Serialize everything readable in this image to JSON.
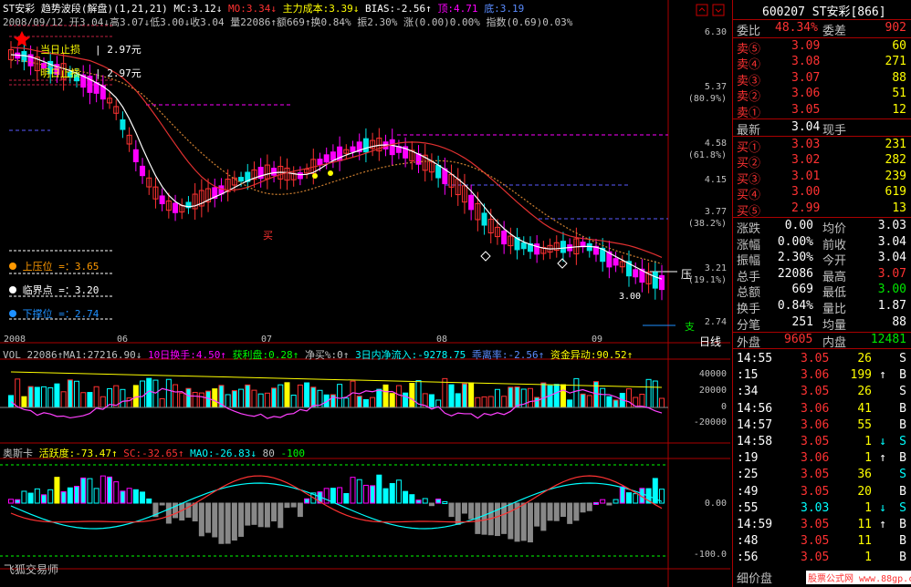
{
  "header": {
    "stock": "ST安彩",
    "indicator": "趋势波段(解盘)(1,21,21)",
    "mc": "MC:3.12↓",
    "mo": "MO:3.34↓",
    "zlcb": "主力成本:3.39↓",
    "bias": "BIAS:-2.56↑",
    "top": "顶:4.71",
    "bottom": "底:3.19",
    "ohlc_line": "2008/09/12 开3.04↓高3.07↓低3.00↓收3.04 量22086↑额669↑换0.84% 振2.30% 涨(0.00)0.00% 指数(0.69)0.03%"
  },
  "main_chart": {
    "today_stop": "当日止损",
    "today_stop_val": "| 2.97元",
    "tomorrow_stop": "明日止损",
    "tomorrow_stop_val": "| 2.97元",
    "buy_label": "买",
    "pressure_label": "压",
    "support_label": "支",
    "low_mark": "3.00",
    "legend": [
      {
        "label": "上压位",
        "value": "=：3.65",
        "color": "#ff9900"
      },
      {
        "label": "临界点",
        "value": "=：3.20",
        "color": "#ffffff"
      },
      {
        "label": "下撑位",
        "value": "=：2.74",
        "color": "#1e90ff"
      }
    ],
    "price_ticks": [
      "6.30",
      "5.37",
      "(80.9%)",
      "4.58",
      "(61.8%)",
      "4.15",
      "3.77",
      "(38.2%)",
      "3.21",
      "(19.1%)",
      "2.74"
    ],
    "months": [
      "2008",
      "06",
      "07",
      "08",
      "09"
    ],
    "y_axis_label": "日线"
  },
  "volume_panel": {
    "header_parts": [
      {
        "t": "VOL 22086↑MA1:27216.90↓",
        "c": "#c0c0c0"
      },
      {
        "t": "10日换手:4.50↑",
        "c": "#ff00ff"
      },
      {
        "t": "获利盘:0.28↑",
        "c": "#00ff00"
      },
      {
        "t": "净买%:0↑",
        "c": "#c0c0c0"
      },
      {
        "t": "3日内净流入:-9278.75",
        "c": "#00ffff"
      },
      {
        "t": "乖离率:-2.56↑",
        "c": "#5a8cff"
      },
      {
        "t": "资金异动:90.52↑",
        "c": "#ffff00"
      }
    ],
    "ticks": [
      "40000",
      "20000",
      "0",
      "-20000"
    ]
  },
  "osc_panel": {
    "header_parts": [
      {
        "t": "奥斯卡",
        "c": "#c0c0c0"
      },
      {
        "t": "活跃度:-73.47↑",
        "c": "#ffff00"
      },
      {
        "t": "SC:-32.65↑",
        "c": "#ff3232"
      },
      {
        "t": "MAO:-26.83↓",
        "c": "#00ffff"
      },
      {
        "t": "80",
        "c": "#c0c0c0"
      },
      {
        "t": "-100",
        "c": "#00ff00"
      }
    ],
    "ticks": [
      "0.00",
      "-100.0"
    ],
    "footer": "飞狐交易师"
  },
  "quote": {
    "code_title": "600207 ST安彩[866]",
    "weibi_label": "委比",
    "weibi_value": "48.34%",
    "weicha_label": "委差",
    "weicha_value": "902",
    "sells": [
      {
        "label": "卖⑤",
        "price": "3.09",
        "vol": "60"
      },
      {
        "label": "卖④",
        "price": "3.08",
        "vol": "271"
      },
      {
        "label": "卖③",
        "price": "3.07",
        "vol": "88"
      },
      {
        "label": "卖②",
        "price": "3.06",
        "vol": "51"
      },
      {
        "label": "卖①",
        "price": "3.05",
        "vol": "12"
      }
    ],
    "latest_label": "最新",
    "latest_value": "3.04",
    "current_hand_label": "现手",
    "current_hand_value": "",
    "buys": [
      {
        "label": "买①",
        "price": "3.03",
        "vol": "231"
      },
      {
        "label": "买②",
        "price": "3.02",
        "vol": "282"
      },
      {
        "label": "买③",
        "price": "3.01",
        "vol": "239"
      },
      {
        "label": "买④",
        "price": "3.00",
        "vol": "619"
      },
      {
        "label": "买⑤",
        "price": "2.99",
        "vol": "13"
      }
    ],
    "stats": [
      {
        "l1": "涨跌",
        "v1": "0.00",
        "l2": "均价",
        "v2": "3.03",
        "c1": "#fff",
        "c2": "#fff"
      },
      {
        "l1": "涨幅",
        "v1": "0.00%",
        "l2": "前收",
        "v2": "3.04",
        "c1": "#fff",
        "c2": "#fff"
      },
      {
        "l1": "振幅",
        "v1": "2.30%",
        "l2": "今开",
        "v2": "3.04",
        "c1": "#fff",
        "c2": "#fff"
      },
      {
        "l1": "总手",
        "v1": "22086",
        "l2": "最高",
        "v2": "3.07",
        "c1": "#fff",
        "c2": "#ff3232"
      },
      {
        "l1": "总额",
        "v1": "669",
        "l2": "最低",
        "v2": "3.00",
        "c1": "#fff",
        "c2": "#00e600"
      },
      {
        "l1": "换手",
        "v1": "0.84%",
        "l2": "量比",
        "v2": "1.87",
        "c1": "#fff",
        "c2": "#fff"
      },
      {
        "l1": "分笔",
        "v1": "251",
        "l2": "均量",
        "v2": "88",
        "c1": "#fff",
        "c2": "#fff"
      }
    ],
    "outer_label": "外盘",
    "outer_value": "9605",
    "inner_label": "内盘",
    "inner_value": "12481",
    "ticks": [
      {
        "time": "14:55",
        "price": "3.05",
        "vol": "26",
        "arrow": "",
        "side": "S",
        "pc": "#ff3232",
        "sc": "#fff"
      },
      {
        "time": ":15",
        "price": "3.06",
        "vol": "199",
        "arrow": "↑",
        "side": "B",
        "pc": "#ff3232",
        "sc": "#fff"
      },
      {
        "time": ":34",
        "price": "3.05",
        "vol": "26",
        "arrow": "",
        "side": "S",
        "pc": "#ff3232",
        "sc": "#fff"
      },
      {
        "time": "14:56",
        "price": "3.06",
        "vol": "41",
        "arrow": "",
        "side": "B",
        "pc": "#ff3232",
        "sc": "#fff"
      },
      {
        "time": "14:57",
        "price": "3.06",
        "vol": "55",
        "arrow": "",
        "side": "B",
        "pc": "#ff3232",
        "sc": "#fff"
      },
      {
        "time": "14:58",
        "price": "3.05",
        "vol": "1",
        "arrow": "↓",
        "side": "S",
        "pc": "#ff3232",
        "sc": "#00ffff"
      },
      {
        "time": ":19",
        "price": "3.06",
        "vol": "1",
        "arrow": "↑",
        "side": "B",
        "pc": "#ff3232",
        "sc": "#fff"
      },
      {
        "time": ":25",
        "price": "3.05",
        "vol": "36",
        "arrow": "",
        "side": "S",
        "pc": "#ff3232",
        "sc": "#00ffff"
      },
      {
        "time": ":49",
        "price": "3.05",
        "vol": "20",
        "arrow": "",
        "side": "B",
        "pc": "#ff3232",
        "sc": "#fff"
      },
      {
        "time": ":55",
        "price": "3.03",
        "vol": "1",
        "arrow": "↓",
        "side": "S",
        "pc": "#00ffff",
        "sc": "#00ffff"
      },
      {
        "time": "14:59",
        "price": "3.05",
        "vol": "11",
        "arrow": "↑",
        "side": "B",
        "pc": "#ff3232",
        "sc": "#fff"
      },
      {
        "time": ":48",
        "price": "3.05",
        "vol": "11",
        "arrow": "",
        "side": "B",
        "pc": "#ff3232",
        "sc": "#fff"
      },
      {
        "time": ":56",
        "price": "3.05",
        "vol": "1",
        "arrow": "",
        "side": "B",
        "pc": "#ff3232",
        "sc": "#fff"
      }
    ],
    "tab_detail": "细价盘",
    "watermark": "股票公式网 www.88gp.com"
  }
}
